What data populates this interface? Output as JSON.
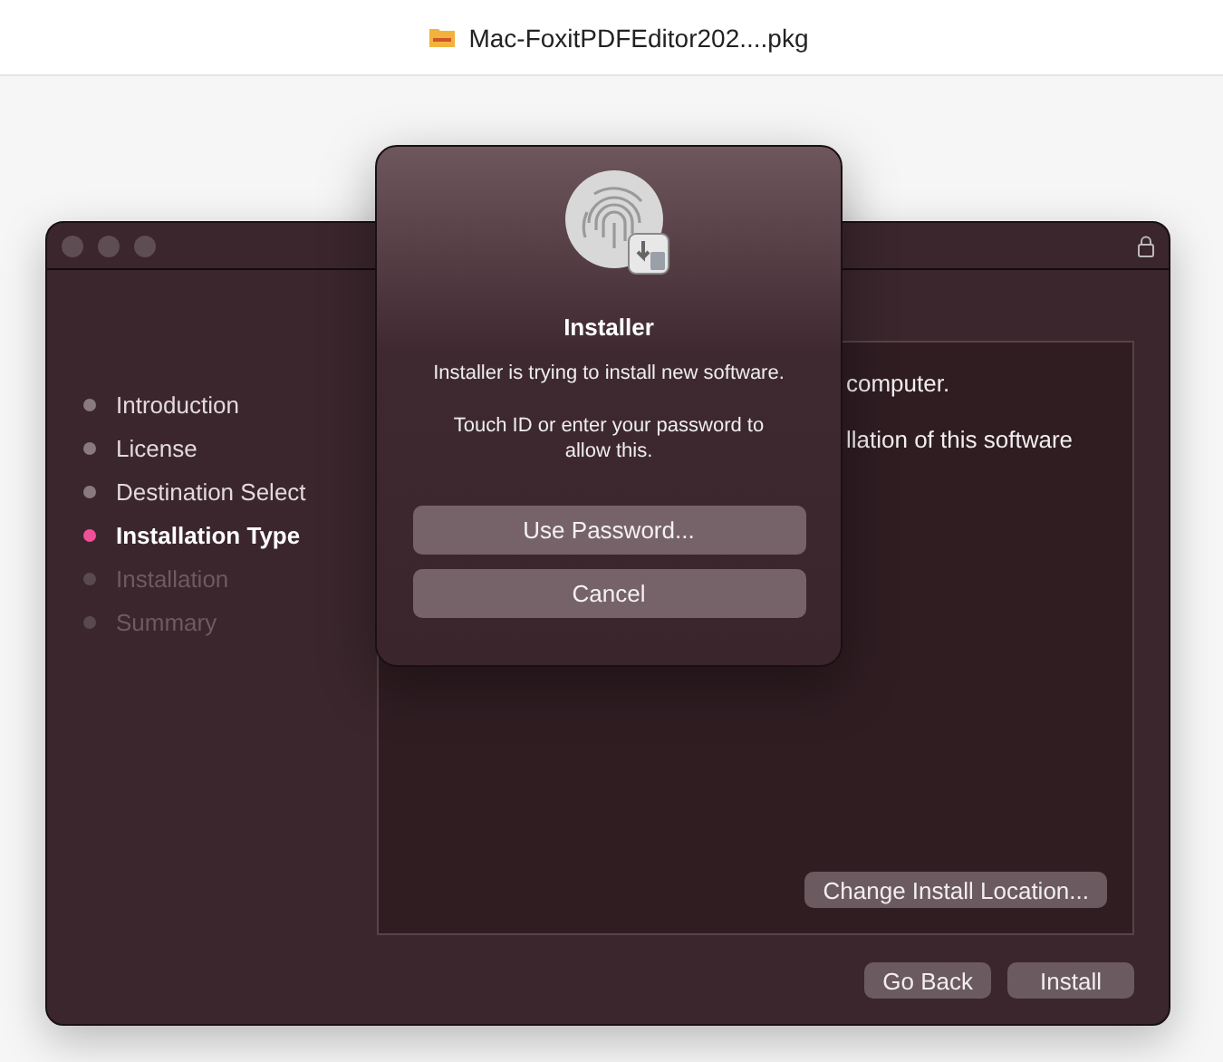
{
  "browser_bar": {
    "file_name": "Mac-FoxitPDFEditor202....pkg"
  },
  "installer_window": {
    "steps": [
      {
        "label": "Introduction",
        "kind": "done"
      },
      {
        "label": "License",
        "kind": "done"
      },
      {
        "label": "Destination Select",
        "kind": "done"
      },
      {
        "label": "Installation Type",
        "kind": "current"
      },
      {
        "label": "Installation",
        "kind": "pending"
      },
      {
        "label": "Summary",
        "kind": "pending"
      }
    ],
    "content_lines": [
      "computer.",
      "llation of this software"
    ],
    "change_location_button": "Change Install Location...",
    "buttons": [
      "Go Back",
      "Install"
    ]
  },
  "auth_dialog": {
    "title": "Installer",
    "message": "Installer is trying to install new software.",
    "prompt": "Touch ID or enter your password to allow this.",
    "buttons": [
      "Use Password...",
      "Cancel"
    ]
  }
}
